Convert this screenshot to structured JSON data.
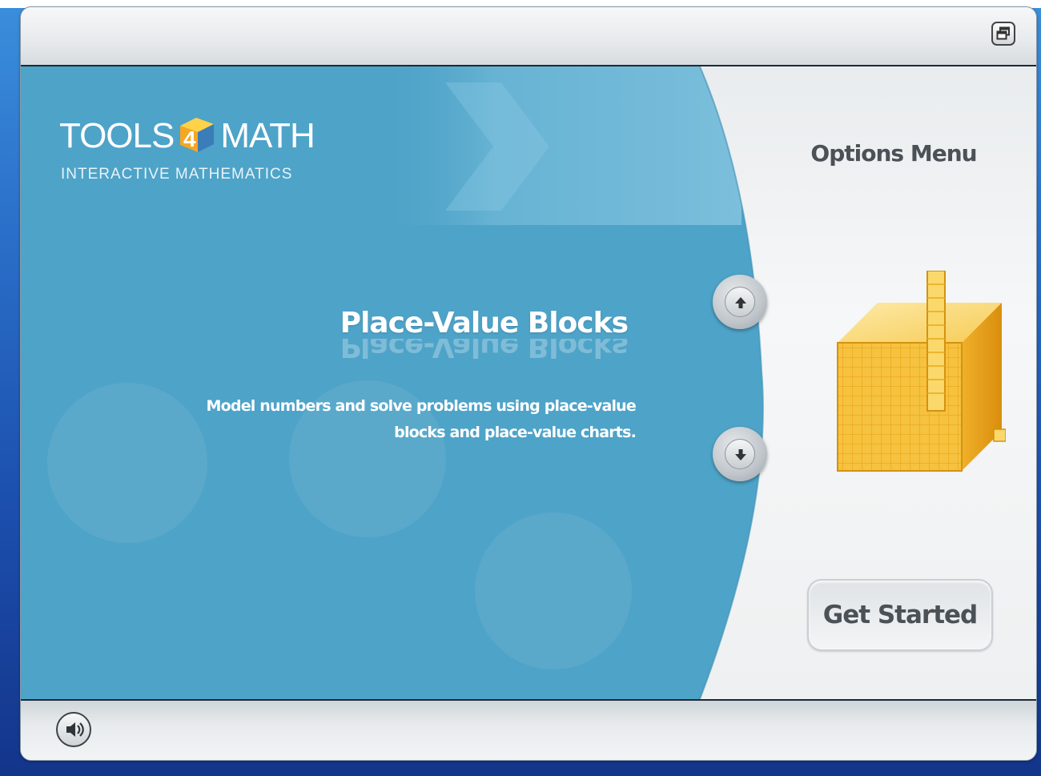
{
  "header": {
    "restore_icon": "window-restore-icon"
  },
  "logo": {
    "word_left": "TOOLS",
    "cube_number": "4",
    "word_right": "MATH",
    "tagline": "INTERACTIVE MATHEMATICS"
  },
  "tool": {
    "title": "Place-Value Blocks",
    "description": "Model numbers and solve problems using place-value blocks and place-value charts."
  },
  "options": {
    "title": "Options Menu",
    "up_icon": "arrow-up-icon",
    "down_icon": "arrow-down-icon",
    "preview_icon": "place-value-cube-icon",
    "get_started_label": "Get Started"
  },
  "footer": {
    "sound_icon": "speaker-icon"
  },
  "colors": {
    "stage_blue": "#4ea3c8",
    "panel_light": "#f4f5f6",
    "cube_gold": "#f2b21c",
    "text_gray": "#4a5157"
  }
}
